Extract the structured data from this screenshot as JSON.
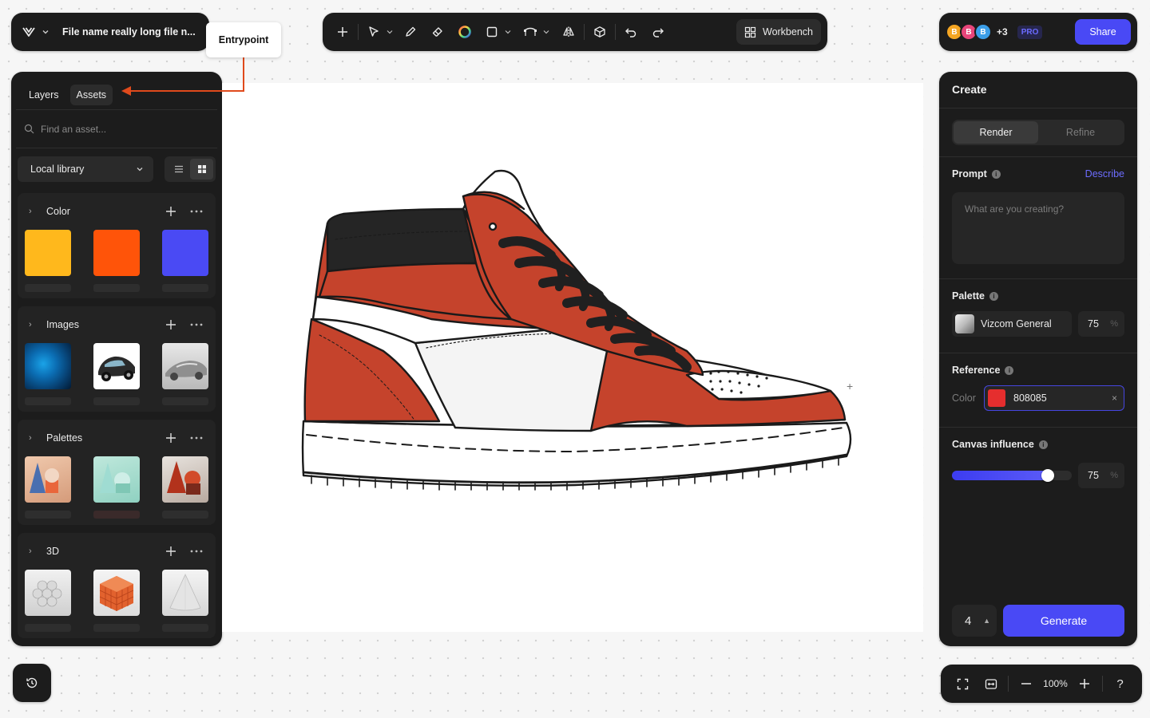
{
  "file": {
    "name": "File name really long file n..."
  },
  "tooltip": {
    "label": "Entrypoint"
  },
  "toolbar": {
    "tools": [
      "plus-icon",
      "select-icon",
      "pen-icon",
      "eraser-icon",
      "color-wheel-icon",
      "rectangle-icon",
      "curve-icon",
      "mirror-icon",
      "3d-cube-icon",
      "undo-icon",
      "redo-icon"
    ],
    "workbench_label": "Workbench"
  },
  "collaborators": {
    "avatars": [
      {
        "initial": "B",
        "color": "#f5a623"
      },
      {
        "initial": "B",
        "color": "#e8457a"
      },
      {
        "initial": "B",
        "color": "#3b9ee8"
      }
    ],
    "more_count": "+3",
    "plan_badge": "PRO",
    "share_label": "Share"
  },
  "left_panel": {
    "tabs": [
      {
        "label": "Layers"
      },
      {
        "label": "Assets"
      }
    ],
    "search_placeholder": "Find an asset...",
    "library_label": "Local library",
    "sections": [
      {
        "title": "Color",
        "swatches": [
          "#ffb81c",
          "#ff5409",
          "#4a4af4"
        ]
      },
      {
        "title": "Images"
      },
      {
        "title": "Palettes"
      },
      {
        "title": "3D"
      }
    ]
  },
  "right_panel": {
    "title": "Create",
    "modes": [
      {
        "label": "Render"
      },
      {
        "label": "Refine"
      }
    ],
    "prompt": {
      "label": "Prompt",
      "action_label": "Describe",
      "placeholder": "What are you creating?"
    },
    "palette": {
      "label": "Palette",
      "name": "Vizcom General",
      "value": "75",
      "unit": "%"
    },
    "reference": {
      "label": "Reference",
      "type_label": "Color",
      "hex": "808085",
      "swatch": "#e52e2e",
      "clear_icon": "×"
    },
    "influence": {
      "label": "Canvas influence",
      "value": "75",
      "unit": "%",
      "fraction": 0.8
    },
    "output_count": "4",
    "generate_label": "Generate"
  },
  "zoom": {
    "level": "100%",
    "help": "?"
  },
  "colors": {
    "accent": "#4949f5",
    "panel": "#1c1c1c",
    "annotation": "#e04a1c"
  }
}
